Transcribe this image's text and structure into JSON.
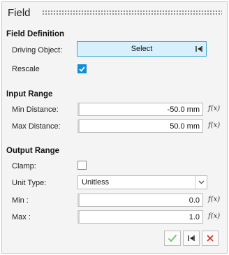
{
  "panel": {
    "title": "Field"
  },
  "field_definition": {
    "heading": "Field Definition",
    "driving_object_label": "Driving Object:",
    "select_label": "Select",
    "rescale_label": "Rescale",
    "rescale_checked": true
  },
  "input_range": {
    "heading": "Input Range",
    "min_label": "Min Distance:",
    "min_value": "-50.0 mm",
    "max_label": "Max Distance:",
    "max_value": "50.0 mm"
  },
  "output_range": {
    "heading": "Output Range",
    "clamp_label": "Clamp:",
    "clamp_checked": false,
    "unit_type_label": "Unit Type:",
    "unit_type_value": "Unitless",
    "min_label": "Min :",
    "min_value": "0.0",
    "max_label": "Max :",
    "max_value": "1.0"
  },
  "fx_symbol": "f(x)",
  "colors": {
    "accent": "#0f8fd6",
    "select_bg": "#d7f0fb",
    "confirm": "#5cb85c",
    "cancel": "#d9342b"
  },
  "icons": {
    "select_icon": "select-target-icon",
    "confirm_icon": "check-icon",
    "select_bottom_icon": "select-target-icon",
    "cancel_icon": "close-icon"
  }
}
